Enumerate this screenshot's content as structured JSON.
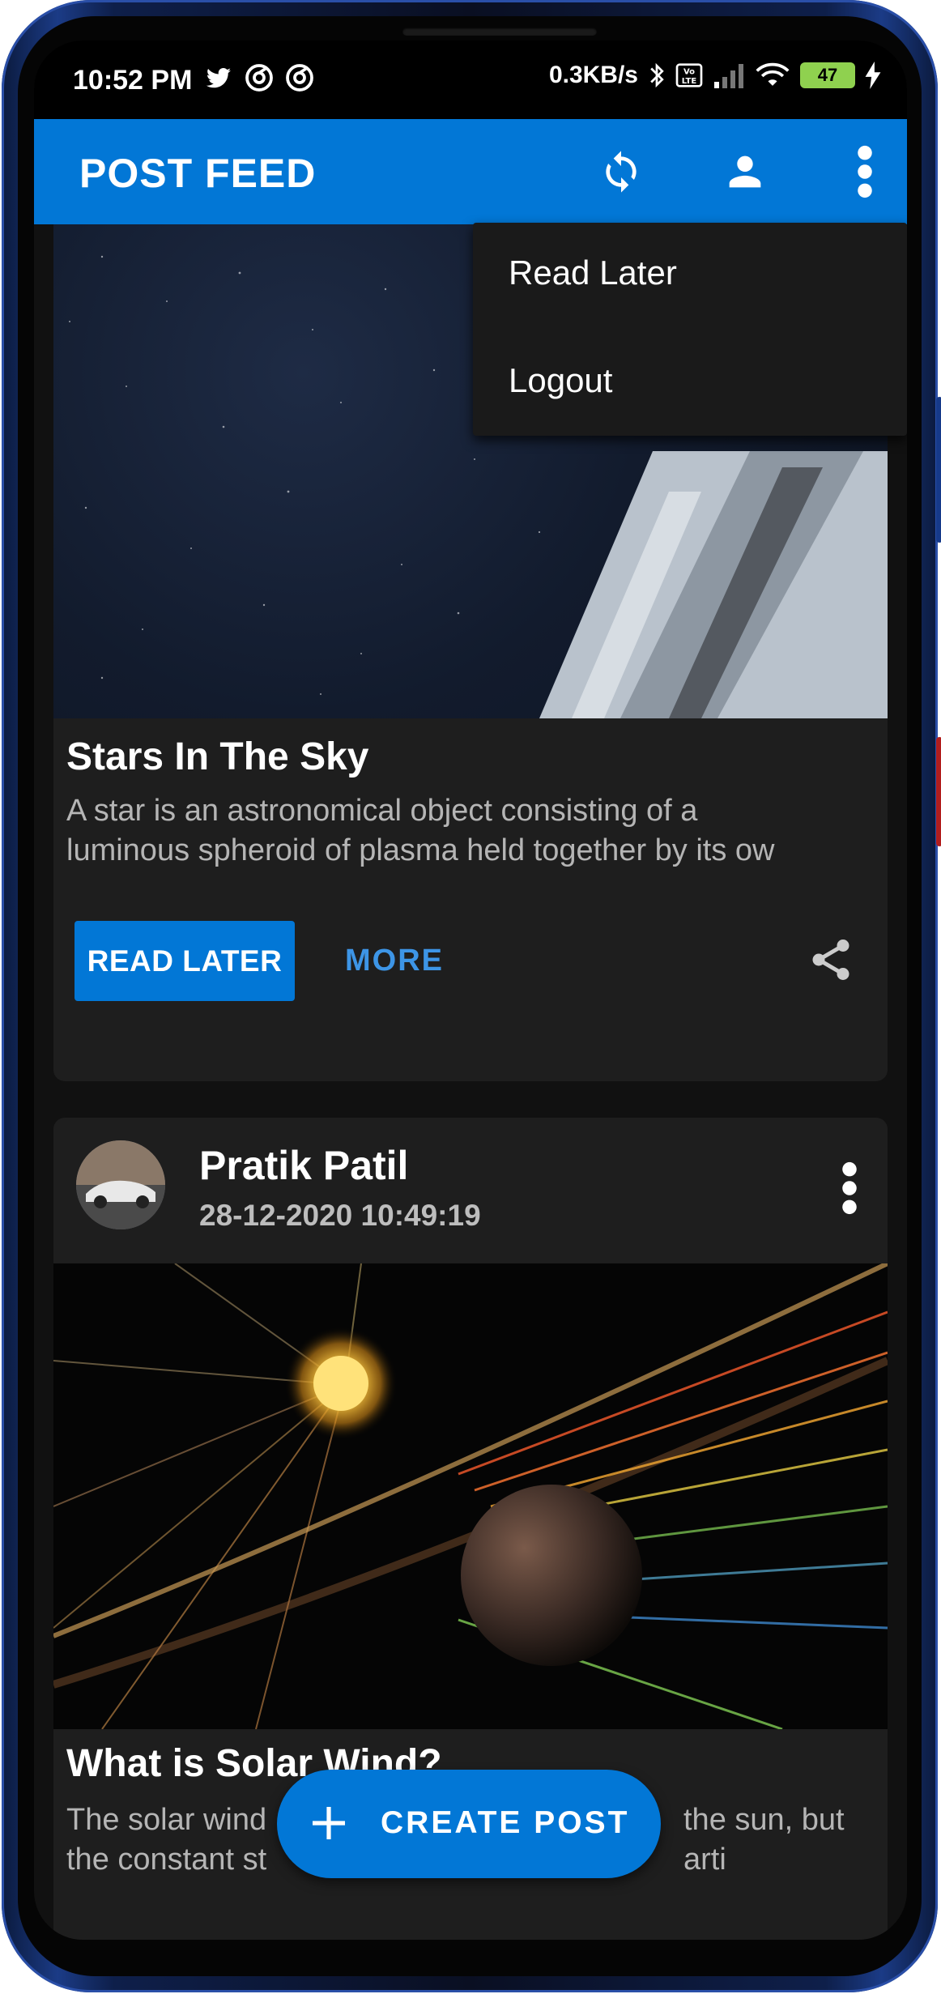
{
  "status_bar": {
    "time": "10:52 PM",
    "network_speed": "0.3KB/s",
    "battery_level": "47",
    "icons_left": [
      "twitter-icon",
      "app-notification-icon",
      "app-notification-icon"
    ],
    "icons_right": [
      "bluetooth-icon",
      "volte-icon",
      "signal-icon",
      "wifi-icon",
      "battery-icon",
      "charging-icon"
    ]
  },
  "app_bar": {
    "title": "POST FEED",
    "actions": [
      "refresh-icon",
      "profile-icon",
      "more-vert-icon"
    ]
  },
  "overflow_menu": {
    "items": [
      {
        "label": "Read Later"
      },
      {
        "label": "Logout"
      }
    ]
  },
  "feed": {
    "posts": [
      {
        "title": "Stars In The Sky",
        "body_line1": "A star is an astronomical object consisting of a",
        "body_line2": "luminous spheroid of plasma held together by its ow",
        "read_later_label": "READ LATER",
        "more_label": "MORE"
      },
      {
        "author": "Pratik Patil",
        "date": "28-12-2020 10:49:19",
        "title": "What is Solar Wind?",
        "body_line1": "The solar wind",
        "body_line1_end": "the sun, but",
        "body_line2": "the constant st",
        "body_line2_end": "arti"
      }
    ]
  },
  "fab": {
    "label": "CREATE POST"
  },
  "colors": {
    "primary": "#0277d6",
    "card_bg": "#1e1e1e",
    "menu_bg": "#1a1a1a",
    "more_text": "#3d95e6"
  }
}
